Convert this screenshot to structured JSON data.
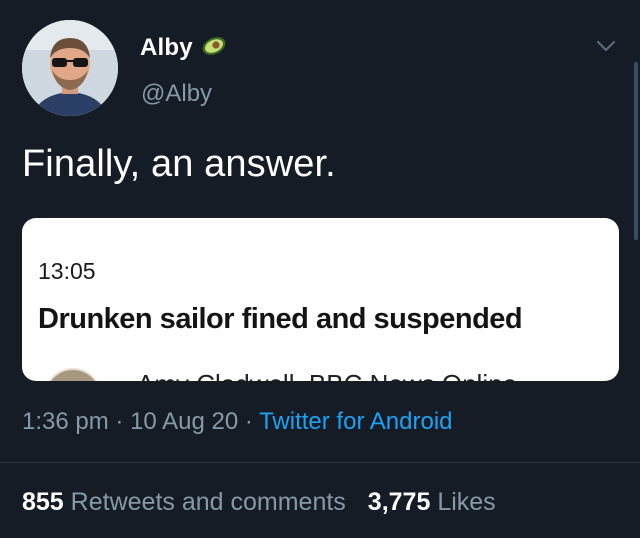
{
  "author": {
    "display_name": "Alby",
    "handle": "@Alby",
    "badge_icon": "avocado-icon"
  },
  "menu_icon": "chevron-down-icon",
  "tweet_text": "Finally, an answer.",
  "card": {
    "time": "13:05",
    "headline": "Drunken sailor fined and suspended",
    "byline": "Amy Cladwell, BBC News Online"
  },
  "meta": {
    "time": "1:36 pm",
    "separator": "·",
    "date": "10 Aug 20",
    "source": "Twitter for Android"
  },
  "stats": {
    "retweets_count": "855",
    "retweets_label": "Retweets and comments",
    "likes_count": "3,775",
    "likes_label": "Likes"
  },
  "colors": {
    "background": "#151c26",
    "secondary_text": "#8899a6",
    "link": "#1da1f2"
  }
}
